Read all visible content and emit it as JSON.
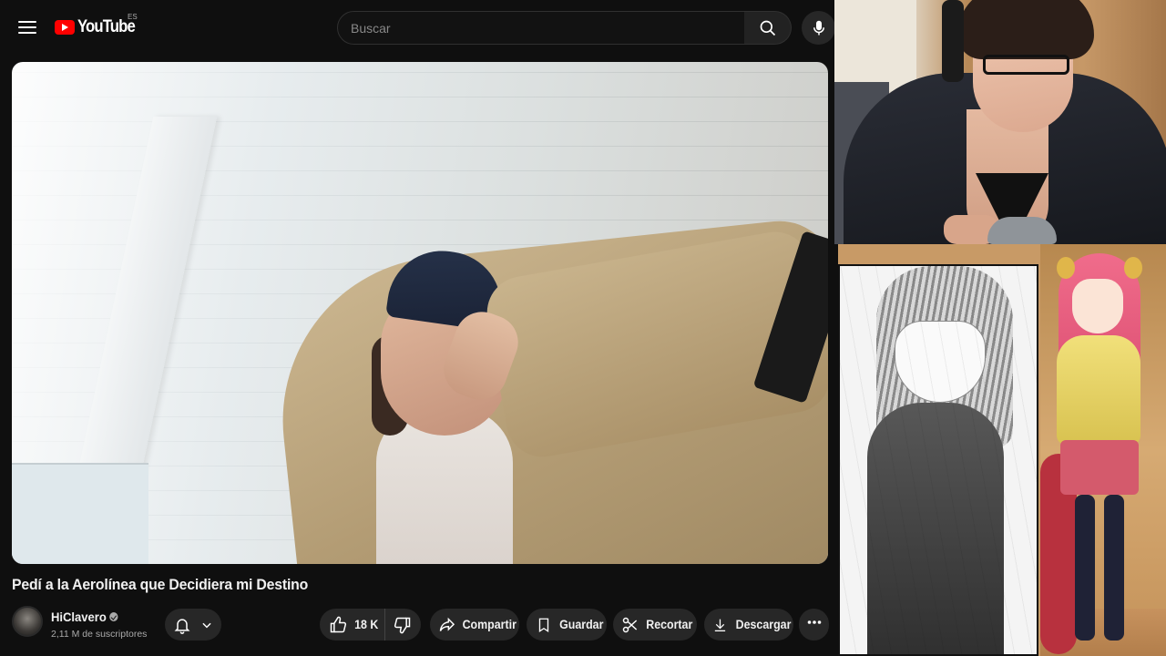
{
  "header": {
    "logo_text": "YouTube",
    "country_code": "ES",
    "search_placeholder": "Buscar"
  },
  "video": {
    "title": "Pedí a la Aerolínea que Decidiera mi Destino",
    "channel_name": "HiClavero",
    "subscribers": "2,11 M de suscriptores",
    "likes": "18 K"
  },
  "actions": {
    "share": "Compartir",
    "save": "Guardar",
    "clip": "Recortar",
    "download": "Descargar"
  },
  "icons": [
    "menu-icon",
    "youtube-logo-icon",
    "search-icon",
    "mic-icon",
    "verified-icon",
    "bell-icon",
    "chevron-down-icon",
    "thumbs-up-icon",
    "thumbs-down-icon",
    "share-icon",
    "bookmark-icon",
    "scissors-icon",
    "download-icon",
    "more-icon"
  ],
  "colors": {
    "background": "#0f0f0f",
    "pill": "#272727",
    "brand_red": "#ff0000",
    "text_primary": "#f1f1f1",
    "text_secondary": "#aaaaaa"
  }
}
